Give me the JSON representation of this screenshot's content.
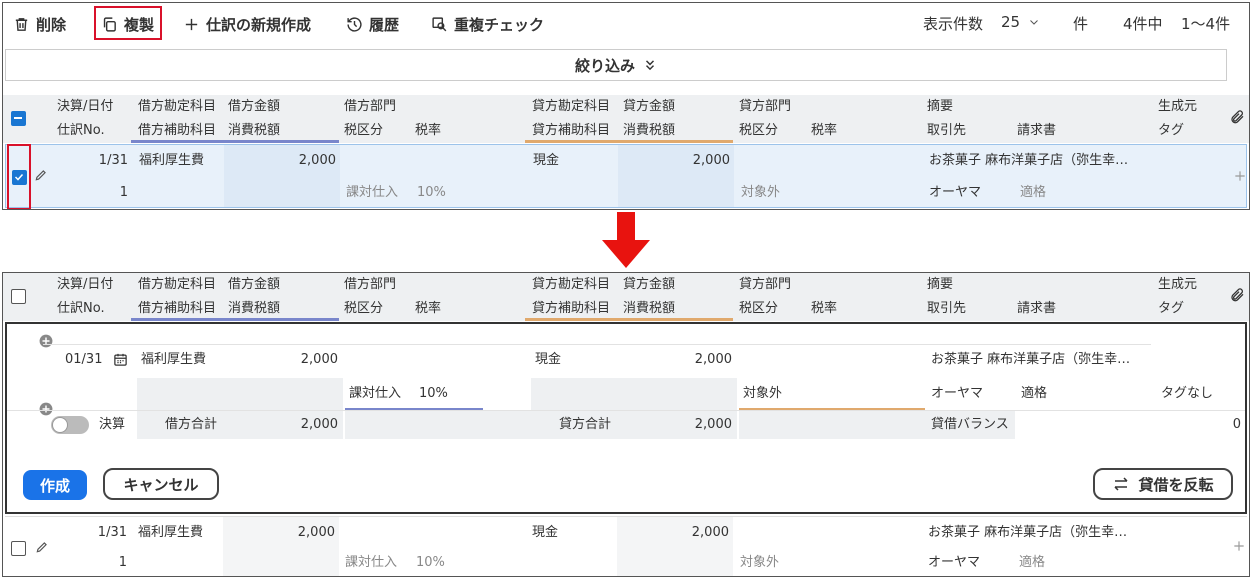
{
  "toolbar": {
    "delete": "削除",
    "duplicate": "複製",
    "new_entry": "仕訳の新規作成",
    "history": "履歴",
    "dup_check": "重複チェック",
    "per_page_label": "表示件数",
    "per_page_value": "25",
    "unit": "件",
    "total": "4件中",
    "range": "1〜4件"
  },
  "filter": {
    "label": "絞り込み"
  },
  "headers": {
    "row1": [
      "決算/日付",
      "借方勘定科目",
      "借方金額",
      "借方部門",
      "貸方勘定科目",
      "貸方金額",
      "貸方部門",
      "摘要",
      "生成元"
    ],
    "row2": [
      "仕訳No.",
      "借方補助科目",
      "消費税額",
      "税区分",
      "税率",
      "貸方補助科目",
      "消費税額",
      "税区分",
      "税率",
      "取引先",
      "請求書",
      "タグ"
    ]
  },
  "entry": {
    "date": "1/31",
    "no": "1",
    "debit_account": "福利厚生費",
    "debit_amount": "2,000",
    "debit_tax_class": "課対仕入",
    "debit_tax_rate": "10%",
    "credit_account": "現金",
    "credit_amount": "2,000",
    "credit_tax_class": "対象外",
    "description": "お茶菓子 麻布洋菓子店（弥生幸…",
    "partner": "オーヤマ",
    "invoice": "適格"
  },
  "form": {
    "date": "01/31",
    "debit_account": "福利厚生費",
    "debit_amount": "2,000",
    "tax_class": "課対仕入",
    "tax_rate": "10%",
    "credit_account": "現金",
    "credit_amount": "2,000",
    "credit_tax_class": "対象外",
    "description": "お茶菓子 麻布洋菓子店（弥生幸…",
    "partner": "オーヤマ",
    "invoice": "適格",
    "tag": "タグなし",
    "settlement_label": "決算",
    "debit_total_label": "借方合計",
    "debit_total": "2,000",
    "credit_total_label": "貸方合計",
    "credit_total": "2,000",
    "balance_label": "貸借バランス",
    "balance": "0",
    "create_button": "作成",
    "cancel_button": "キャンセル",
    "swap_button": "貸借を反転"
  },
  "colors": {
    "accent": "#1a73e8",
    "highlight": "#d9112a",
    "debit_line": "#7986cb",
    "credit_line": "#e0a96d"
  }
}
